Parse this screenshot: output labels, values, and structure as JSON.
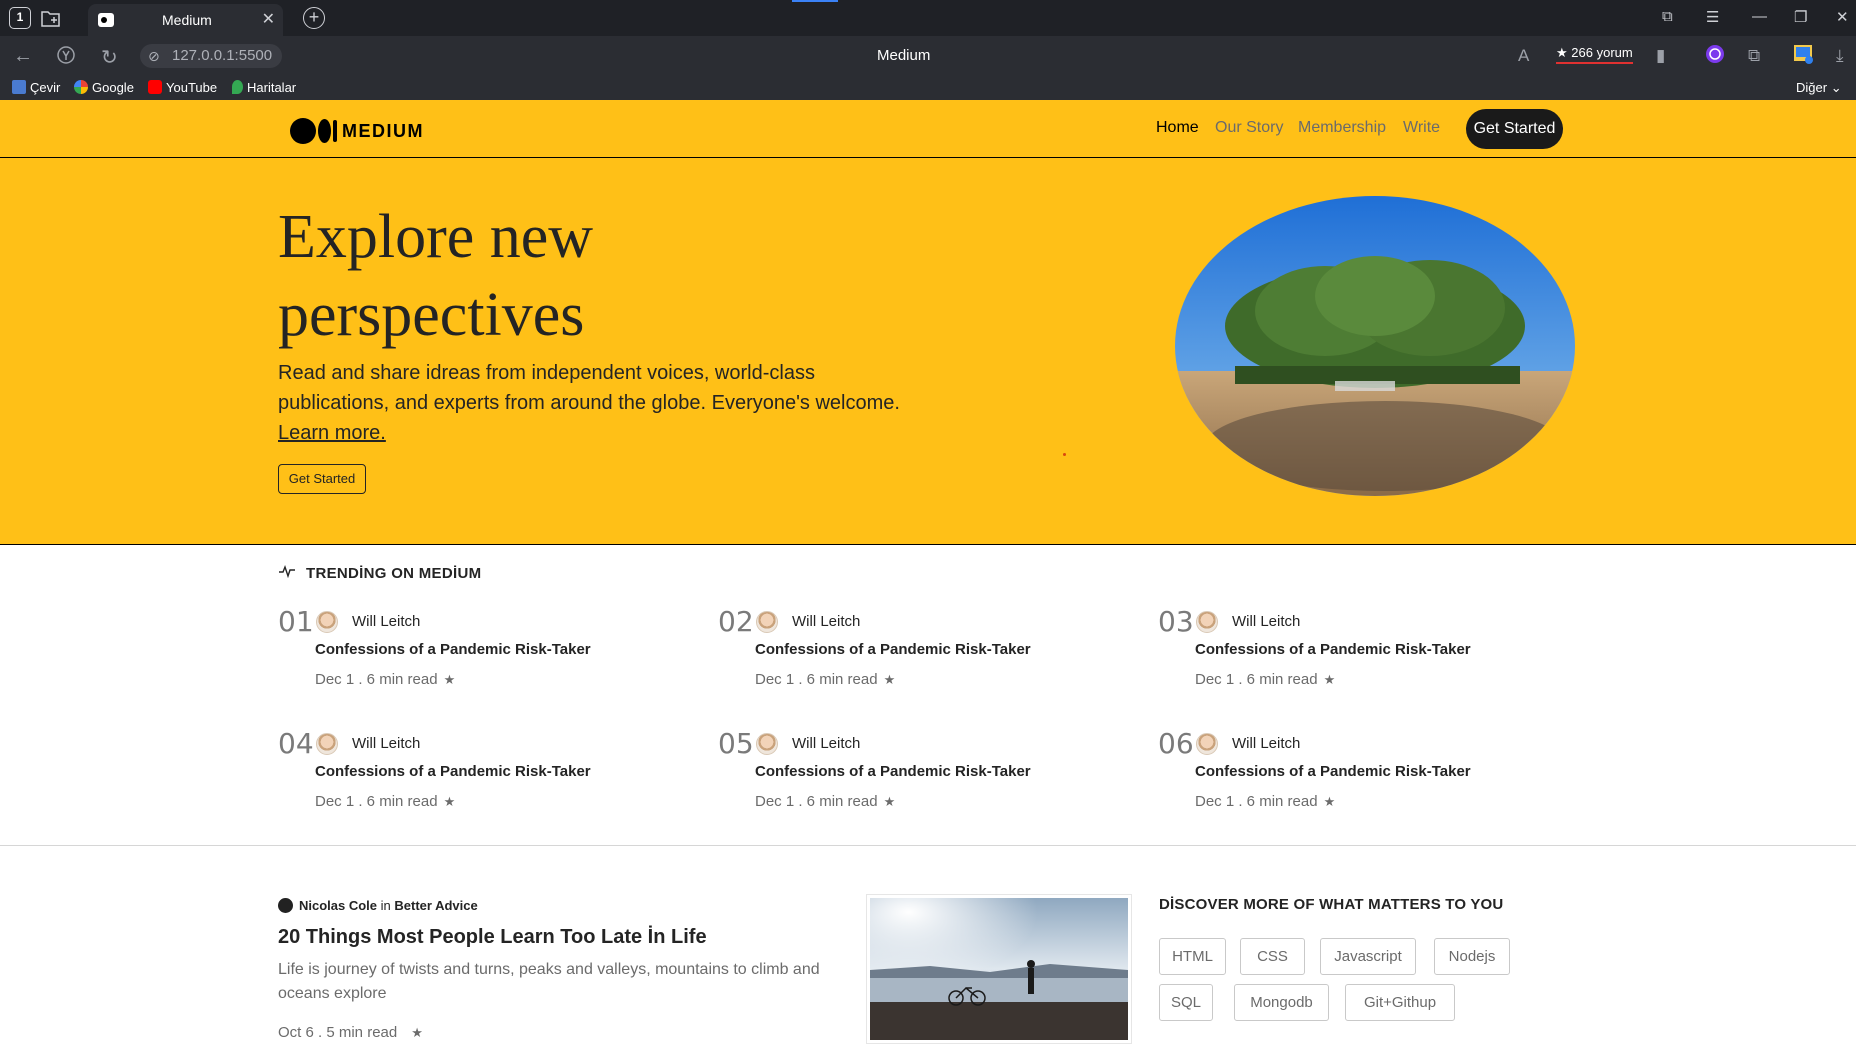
{
  "browser": {
    "tab_number": "1",
    "tab_title": "Medium",
    "url": "127.0.0.1:5500",
    "page_title": "Medium",
    "reviews": "266 yorum",
    "bookmarks": [
      "Çevir",
      "Google",
      "YouTube",
      "Haritalar"
    ],
    "bookmarks_more": "Diğer"
  },
  "header": {
    "logo_text": "MEDIUM",
    "nav": [
      "Home",
      "Our Story",
      "Membership",
      "Write"
    ],
    "cta": "Get Started"
  },
  "hero": {
    "title_line1": "Explore new",
    "title_line2": "perspectives",
    "subtitle": "Read and share idreas from independent voices, world-class publications, and experts from around the globe. Everyone's welcome.",
    "learn_more": "Learn more.",
    "button": "Get Started"
  },
  "trending": {
    "heading": "TRENDİNG ON MEDİUM",
    "items": [
      {
        "num": "01",
        "author": "Will Leitch",
        "title": "Confessions of a Pandemic Risk-Taker",
        "meta": "Dec 1 . 6 min read"
      },
      {
        "num": "02",
        "author": "Will Leitch",
        "title": "Confessions of a Pandemic Risk-Taker",
        "meta": "Dec 1 . 6 min read"
      },
      {
        "num": "03",
        "author": "Will Leitch",
        "title": "Confessions of a Pandemic Risk-Taker",
        "meta": "Dec 1 . 6 min read"
      },
      {
        "num": "04",
        "author": "Will Leitch",
        "title": "Confessions of a Pandemic Risk-Taker",
        "meta": "Dec 1 . 6 min read"
      },
      {
        "num": "05",
        "author": "Will Leitch",
        "title": "Confessions of a Pandemic Risk-Taker",
        "meta": "Dec 1 . 6 min read"
      },
      {
        "num": "06",
        "author": "Will Leitch",
        "title": "Confessions of a Pandemic Risk-Taker",
        "meta": "Dec 1 . 6 min read"
      }
    ]
  },
  "post": {
    "author": "Nicolas Cole",
    "in": "in",
    "publication": "Better Advice",
    "title": "20 Things Most People Learn Too Late İn Life",
    "description": "Life is journey of twists and turns, peaks and valleys, mountains to climb and oceans explore",
    "meta": "Oct 6  .  5 min read"
  },
  "discover": {
    "heading": "DİSCOVER MORE OF WHAT MATTERS TO YOU",
    "tags": [
      "HTML",
      "CSS",
      "Javascript",
      "Nodejs",
      "SQL",
      "Mongodb",
      "Git+Githup"
    ]
  },
  "colors": {
    "brand_yellow": "#ffc017",
    "text_dark": "#242424",
    "text_muted": "#6b6b6b"
  }
}
